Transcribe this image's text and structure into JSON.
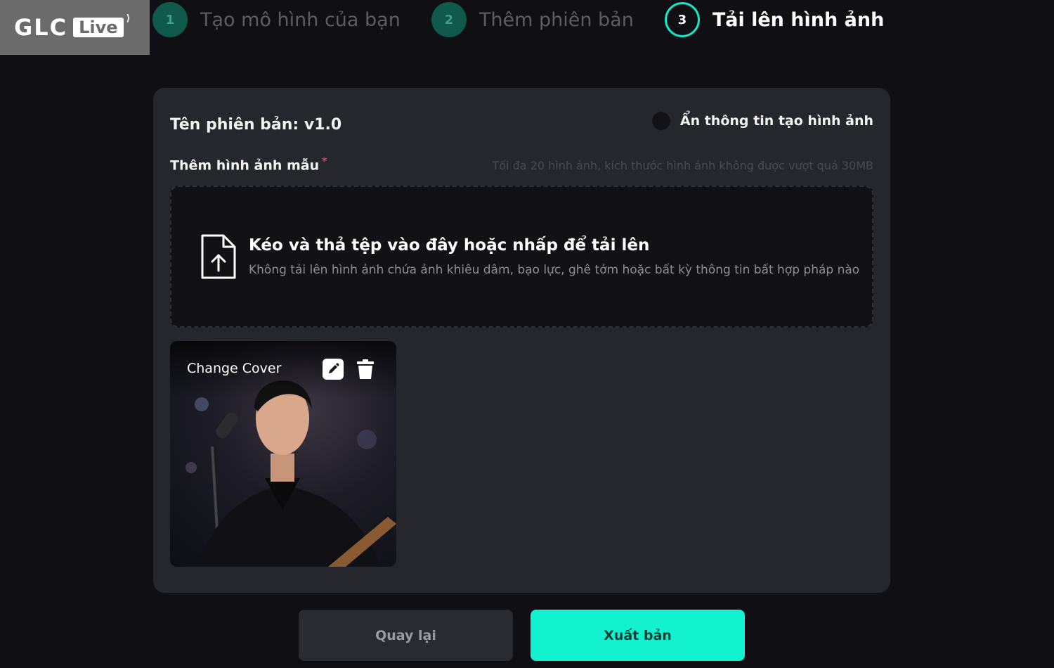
{
  "logo": {
    "text": "GLC",
    "badge": "Live"
  },
  "steps": [
    {
      "number": "1",
      "label": "Tạo mô hình của bạn",
      "state": "done"
    },
    {
      "number": "2",
      "label": "Thêm phiên bản",
      "state": "done"
    },
    {
      "number": "3",
      "label": "Tải lên hình ảnh",
      "state": "active"
    }
  ],
  "card": {
    "version_title": "Tên phiên bản: v1.0",
    "hide_toggle_label": "Ẩn thông tin tạo hình ảnh",
    "hide_toggle_on": false,
    "sample_label": "Thêm hình ảnh mẫu",
    "required_mark": "*",
    "limit_hint": "Tối đa 20 hình ảnh, kích thước hình ảnh không được vượt quá 30MB",
    "dropzone": {
      "icon": "file-upload-icon",
      "title": "Kéo và thả tệp vào đây hoặc nhấp để tải lên",
      "subtitle": "Không tải lên hình ảnh chứa ảnh khiêu dâm, bạo lực, ghê tởm hoặc bất kỳ thông tin bất hợp pháp nào"
    },
    "thumbnail": {
      "change_cover": "Change Cover",
      "edit_icon": "edit-icon",
      "delete_icon": "trash-icon"
    }
  },
  "buttons": {
    "back": "Quay lại",
    "publish": "Xuất bản"
  },
  "colors": {
    "accent": "#12f2cf",
    "background": "#101014",
    "card": "#26262d"
  }
}
